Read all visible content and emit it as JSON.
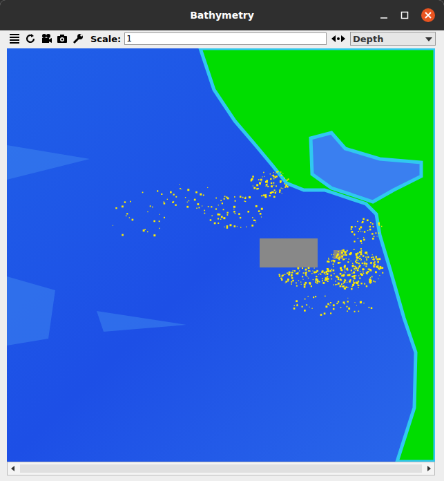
{
  "window": {
    "title": "Bathymetry"
  },
  "toolbar": {
    "scale_label": "Scale:",
    "scale_value": "1",
    "layer": "Depth"
  }
}
